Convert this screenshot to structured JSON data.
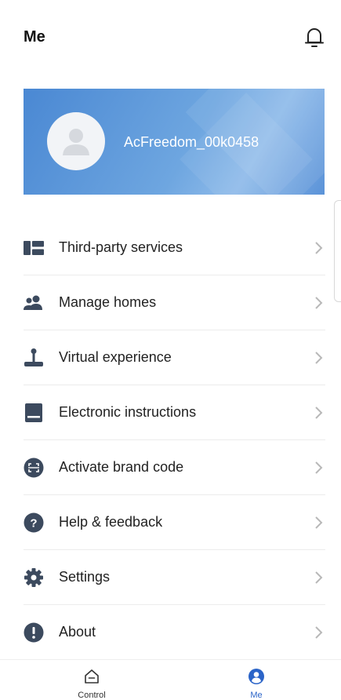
{
  "header": {
    "title": "Me"
  },
  "profile": {
    "username": "AcFreedom_00k0458"
  },
  "menu": {
    "items": [
      {
        "label": "Third-party services",
        "icon": "services-icon"
      },
      {
        "label": "Manage homes",
        "icon": "people-icon"
      },
      {
        "label": "Virtual experience",
        "icon": "joystick-icon"
      },
      {
        "label": "Electronic instructions",
        "icon": "book-icon"
      },
      {
        "label": "Activate brand code",
        "icon": "scan-code-icon"
      },
      {
        "label": "Help & feedback",
        "icon": "question-icon"
      },
      {
        "label": "Settings",
        "icon": "gear-icon"
      },
      {
        "label": "About",
        "icon": "info-icon"
      }
    ]
  },
  "bottom_nav": {
    "items": [
      {
        "label": "Control",
        "active": false
      },
      {
        "label": "Me",
        "active": true
      }
    ]
  },
  "colors": {
    "accent": "#2b64c8",
    "card_gradient_start": "#4a88d3",
    "card_gradient_end": "#8fbbea",
    "icon": "#3c4a5e"
  }
}
